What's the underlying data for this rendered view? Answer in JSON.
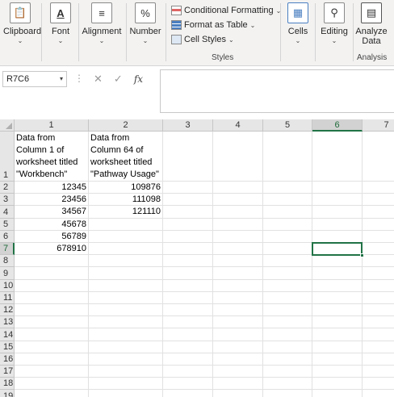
{
  "ribbon": {
    "clipboard": {
      "label": "Clipboard",
      "icon": "clipboard-icon"
    },
    "font": {
      "label": "Font",
      "icon": "font-icon"
    },
    "alignment": {
      "label": "Alignment",
      "icon": "alignment-icon"
    },
    "number": {
      "label": "Number",
      "icon": "percent-icon"
    },
    "styles": {
      "conditional_formatting": "Conditional Formatting",
      "format_as_table": "Format as Table",
      "cell_styles": "Cell Styles",
      "group_label": "Styles"
    },
    "cells": {
      "label": "Cells",
      "icon": "cells-icon"
    },
    "editing": {
      "label": "Editing",
      "icon": "search-icon"
    },
    "analyze": {
      "label_line1": "Analyze",
      "label_line2": "Data",
      "group_label": "Analysis",
      "icon": "analyze-data-icon"
    }
  },
  "formula_bar": {
    "name_box": "R7C6",
    "formula": ""
  },
  "sheet": {
    "column_headers": [
      "1",
      "2",
      "3",
      "4",
      "5",
      "6",
      "7"
    ],
    "row_headers": [
      "1",
      "2",
      "3",
      "4",
      "5",
      "6",
      "7",
      "8",
      "9",
      "10",
      "11",
      "12",
      "13",
      "14",
      "15",
      "16",
      "17",
      "18",
      "19"
    ],
    "header_cells": {
      "c1": "Data from\nColumn 1 of\nworksheet titled\n\"Workbench\"",
      "c2": "Data from\nColumn 64 of\nworksheet titled\n\"Pathway Usage\""
    },
    "column1_values": [
      "12345",
      "23456",
      "34567",
      "45678",
      "56789",
      "678910"
    ],
    "column2_values": [
      "109876",
      "111098",
      "121110"
    ],
    "selected_cell": "R7C6",
    "accent_color": "#217346"
  }
}
